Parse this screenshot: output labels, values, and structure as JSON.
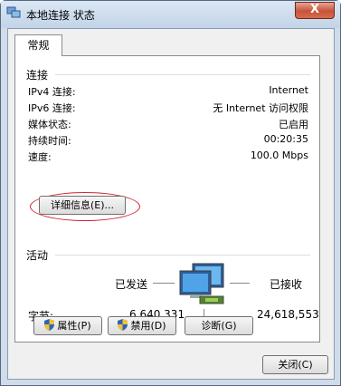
{
  "window": {
    "title": "本地连接 状态",
    "close_label": "X"
  },
  "tabs": [
    {
      "label": "常规"
    }
  ],
  "connection": {
    "section_label": "连接",
    "rows": [
      {
        "key": "IPv4 连接:",
        "value": "Internet"
      },
      {
        "key": "IPv6 连接:",
        "value": "无 Internet 访问权限"
      },
      {
        "key": "媒体状态:",
        "value": "已启用"
      },
      {
        "key": "持续时间:",
        "value": "00:20:35"
      },
      {
        "key": "速度:",
        "value": "100.0 Mbps"
      }
    ],
    "details_button": "详细信息(E)..."
  },
  "activity": {
    "section_label": "活动",
    "sent_label": "已发送",
    "received_label": "已接收",
    "bytes_label": "字节:",
    "bytes_sent": "6,640,331",
    "bytes_received": "24,618,553"
  },
  "buttons": {
    "properties": "属性(P)",
    "disable": "禁用(D)",
    "diagnose": "诊断(G)",
    "close": "关闭(C)"
  },
  "icons": {
    "title": "network-connection-icon",
    "network": "network-computers-icon",
    "shield": "uac-shield-icon"
  },
  "colors": {
    "highlight_ellipse": "#d2242f",
    "title_bar": "#cfdcea",
    "close_button": "#c7523a"
  }
}
